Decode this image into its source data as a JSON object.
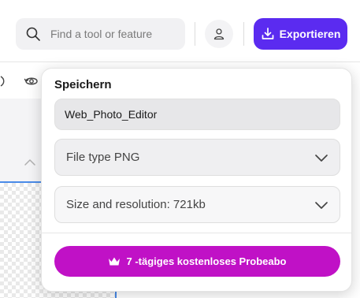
{
  "search": {
    "placeholder": "Find a tool or feature",
    "icon": "search-icon"
  },
  "header": {
    "export_label": "Exportieren",
    "accent": "#5b2bf0"
  },
  "save_panel": {
    "title": "Speichern",
    "file_name": "Web_Photo_Editor",
    "file_type": "File type PNG",
    "size_resolution": "Size and resolution: 721kb",
    "trial_label": "7 -tägiges kostenloses Probeabo",
    "trial_color": "#c011c6"
  }
}
